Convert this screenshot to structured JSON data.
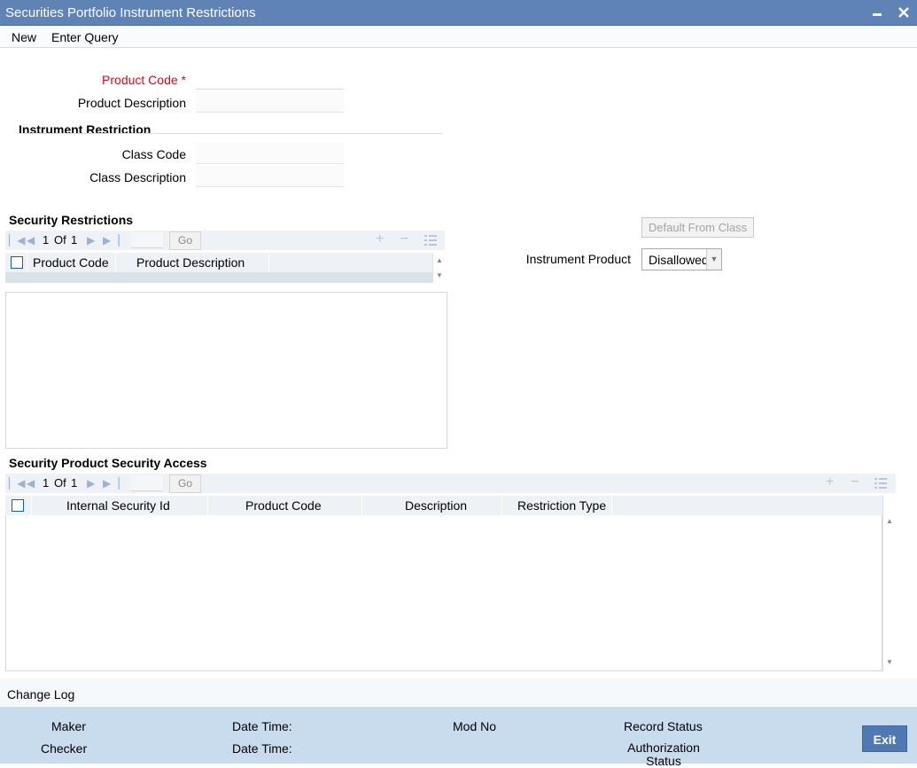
{
  "window": {
    "title": "Securities Portfolio Instrument Restrictions",
    "minimize_icon": "minimize-icon",
    "close_icon": "close-icon"
  },
  "menu": {
    "new": "New",
    "enter_query": "Enter Query"
  },
  "form": {
    "product_code_label": "Product Code",
    "required_marker": "*",
    "product_code_value": "",
    "product_description_label": "Product Description",
    "product_description_value": ""
  },
  "instrument_restriction": {
    "title": "Instrument Restriction",
    "class_code_label": "Class Code",
    "class_code_value": "",
    "class_description_label": "Class Description",
    "class_description_value": ""
  },
  "security_restrictions": {
    "title": "Security Restrictions",
    "pager": {
      "current": "1",
      "of": "Of",
      "total": "1",
      "go": "Go"
    },
    "columns": [
      "Product Code",
      "Product Description"
    ]
  },
  "right_panel": {
    "default_from_class": "Default From Class",
    "instrument_product_label": "Instrument Product",
    "instrument_product_value": "Disallowed"
  },
  "security_product_access": {
    "title": "Security Product Security Access",
    "pager": {
      "current": "1",
      "of": "Of",
      "total": "1",
      "go": "Go"
    },
    "columns": [
      "Internal Security Id",
      "Product Code",
      "Description",
      "Restriction Type"
    ]
  },
  "change_log": "Change Log",
  "footer": {
    "maker": "Maker",
    "checker": "Checker",
    "date_time_1": "Date Time:",
    "date_time_2": "Date Time:",
    "mod_no": "Mod No",
    "record_status": "Record Status",
    "authorization_status": "Authorization Status",
    "exit": "Exit"
  }
}
